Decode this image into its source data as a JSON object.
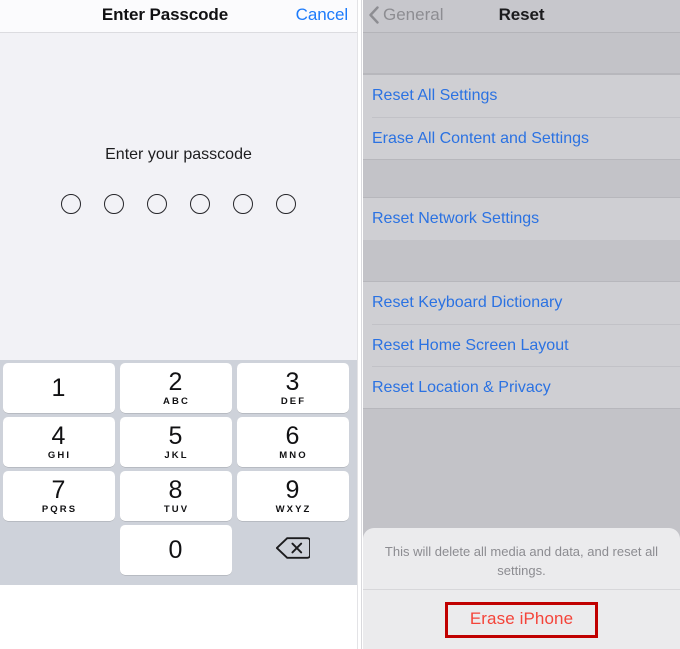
{
  "passcode_panel": {
    "navbar": {
      "title": "Enter Passcode",
      "cancel_label": "Cancel"
    },
    "prompt": "Enter your passcode",
    "dots_total": 6,
    "dots_filled": 0,
    "keypad": {
      "keys": [
        {
          "digit": "1",
          "letters": ""
        },
        {
          "digit": "2",
          "letters": "ABC"
        },
        {
          "digit": "3",
          "letters": "DEF"
        },
        {
          "digit": "4",
          "letters": "GHI"
        },
        {
          "digit": "5",
          "letters": "JKL"
        },
        {
          "digit": "6",
          "letters": "MNO"
        },
        {
          "digit": "7",
          "letters": "PQRS"
        },
        {
          "digit": "8",
          "letters": "TUV"
        },
        {
          "digit": "9",
          "letters": "WXYZ"
        },
        {
          "digit": "0",
          "letters": ""
        }
      ],
      "delete_icon": "backspace-icon"
    }
  },
  "reset_panel": {
    "navbar": {
      "back_label": "General",
      "back_icon": "chevron-left-icon",
      "title": "Reset"
    },
    "groups": [
      {
        "rows": [
          {
            "label": "Reset All Settings"
          },
          {
            "label": "Erase All Content and Settings"
          }
        ]
      },
      {
        "rows": [
          {
            "label": "Reset Network Settings"
          }
        ]
      },
      {
        "rows": [
          {
            "label": "Reset Keyboard Dictionary"
          },
          {
            "label": "Reset Home Screen Layout"
          },
          {
            "label": "Reset Location & Privacy"
          }
        ]
      }
    ],
    "alert": {
      "message": "This will delete all media and data, and reset all settings.",
      "destructive_label": "Erase iPhone"
    }
  },
  "colors": {
    "link_blue": "#2b72e2",
    "cancel_blue": "#1d7bfb",
    "destructive_red": "#f4443a",
    "annotation_red": "#c00000",
    "panel_gray": "#c3c3c8",
    "row_gray": "#cfcfd3",
    "keypad_gray": "#ced2da",
    "passcode_bg": "#f2f2f6"
  }
}
